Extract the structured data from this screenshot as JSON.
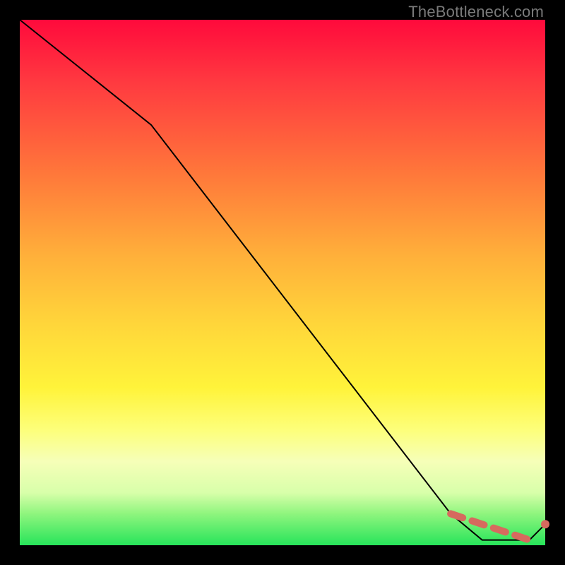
{
  "attribution": "TheBottleneck.com",
  "colors": {
    "line": "#000000",
    "dash": "#d66a5e",
    "gradient_top": "#ff0a3c",
    "gradient_bottom": "#27e45a"
  },
  "chart_data": {
    "type": "line",
    "title": "",
    "xlabel": "",
    "ylabel": "",
    "xlim": [
      0,
      100
    ],
    "ylim": [
      0,
      100
    ],
    "x": [
      0,
      25,
      82,
      88,
      97,
      100
    ],
    "values": [
      100,
      80,
      6,
      1,
      1,
      4
    ],
    "annotations": [
      {
        "kind": "dashed-segment",
        "x": [
          82,
          97
        ],
        "values": [
          6,
          1
        ],
        "color": "#d66a5e"
      },
      {
        "kind": "point",
        "x": 100,
        "value": 4,
        "color": "#d66a5e"
      }
    ]
  }
}
